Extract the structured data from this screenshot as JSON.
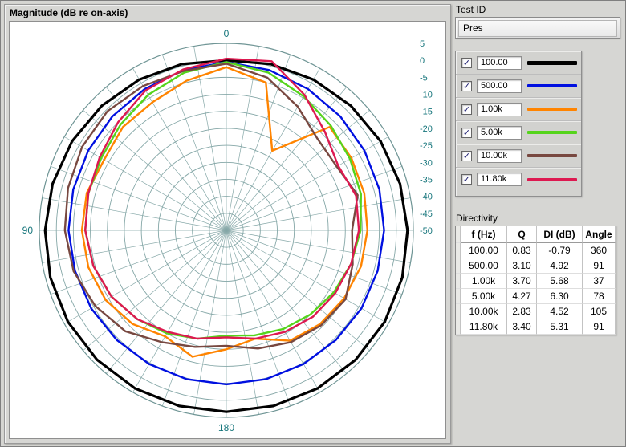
{
  "plot": {
    "title": "Magnitude (dB re on-axis)"
  },
  "test_id": {
    "label": "Test ID",
    "value": "Pres"
  },
  "legend": {
    "items": [
      {
        "label": "100.00",
        "checked": true
      },
      {
        "label": "500.00",
        "checked": true
      },
      {
        "label": "1.00k",
        "checked": true
      },
      {
        "label": "5.00k",
        "checked": true
      },
      {
        "label": "10.00k",
        "checked": true
      },
      {
        "label": "11.80k",
        "checked": true
      }
    ],
    "check_glyph": "✓"
  },
  "directivity": {
    "label": "Directivity",
    "headers": [
      "f (Hz)",
      "Q",
      "DI (dB)",
      "Angle"
    ],
    "rows": [
      [
        "100.00",
        "0.83",
        "-0.79",
        "360"
      ],
      [
        "500.00",
        "3.10",
        "4.92",
        "91"
      ],
      [
        "1.00k",
        "3.70",
        "5.68",
        "37"
      ],
      [
        "5.00k",
        "4.27",
        "6.30",
        "78"
      ],
      [
        "10.00k",
        "2.83",
        "4.52",
        "105"
      ],
      [
        "11.80k",
        "3.40",
        "5.31",
        "91"
      ]
    ]
  },
  "chart_data": {
    "type": "line",
    "subtype": "polar",
    "title": "Magnitude (dB re on-axis)",
    "radial_axis": {
      "min": -50,
      "max": 5,
      "step": 5,
      "labels": [
        "5",
        "0",
        "-5",
        "-10",
        "-15",
        "-20",
        "-25",
        "-30",
        "-35",
        "-40",
        "-45",
        "-50"
      ]
    },
    "angle_labels": [
      {
        "text": "0",
        "deg": 0
      },
      {
        "text": "90",
        "deg": 90
      },
      {
        "text": "180",
        "deg": 180
      }
    ],
    "angle_step_deg": 15,
    "grid_spoke_step_deg": 10,
    "grid_color": "#85a7a7",
    "outer_ring_color": "#6f9595",
    "label_color": "#17767c",
    "series": [
      {
        "name": "100.00",
        "color": "#000000",
        "width": 3.2,
        "values": [
          0,
          0.6,
          1.2,
          1.8,
          2.4,
          2.9,
          3.3,
          3.6,
          3.8,
          3.8,
          3.7,
          3.5,
          3.4,
          3.5,
          3.7,
          3.8,
          3.8,
          3.6,
          3.3,
          2.9,
          2.4,
          1.8,
          1.2,
          0.6,
          0
        ]
      },
      {
        "name": "500.00",
        "color": "#0010e0",
        "width": 2.4,
        "values": [
          -0.5,
          -1.2,
          -2.0,
          -2.6,
          -3.1,
          -3.4,
          -3.6,
          -3.9,
          -4.1,
          -4.4,
          -4.6,
          -4.7,
          -4.7,
          -4.7,
          -4.6,
          -4.4,
          -4.1,
          -3.9,
          -3.6,
          -3.4,
          -3.1,
          -2.6,
          -2.0,
          -1.2,
          -0.5
        ]
      },
      {
        "name": "1.00k",
        "color": "#ff8400",
        "width": 2.4,
        "values": [
          -2,
          -4.5,
          -6.5,
          -7,
          -8.5,
          -7.5,
          -7.5,
          -8,
          -9,
          -11,
          -14,
          -11.5,
          -15,
          -17,
          -12.5,
          -11,
          -10,
          -9,
          -8.5,
          -8,
          -7.5,
          -7,
          -23,
          -5,
          -2
        ]
      },
      {
        "name": "5.00k",
        "color": "#55d41c",
        "width": 2.4,
        "values": [
          -0.5,
          -2,
          -4,
          -6,
          -7.5,
          -8,
          -8.5,
          -9.5,
          -11,
          -13,
          -15,
          -17,
          -19,
          -18,
          -16.5,
          -15,
          -13.5,
          -12,
          -10.5,
          -9,
          -8,
          -6.5,
          -4.5,
          -2,
          -0.5
        ]
      },
      {
        "name": "10.00k",
        "color": "#784840",
        "width": 2.4,
        "values": [
          -1,
          -1.5,
          -1,
          -0.5,
          -1,
          -1.8,
          -2.5,
          -3.5,
          -5.5,
          -8,
          -12,
          -14.5,
          -16,
          -14,
          -12,
          -10.5,
          -9.5,
          -11.5,
          -13,
          -10,
          -12.5,
          -12,
          -8,
          -3.5,
          -1
        ]
      },
      {
        "name": "11.80k",
        "color": "#dd1950",
        "width": 2.4,
        "values": [
          0.5,
          -1,
          -2.5,
          -5,
          -7,
          -8,
          -8.5,
          -9.5,
          -11,
          -13,
          -15.5,
          -17,
          -18.5,
          -17,
          -15.5,
          -14,
          -13,
          -12,
          -11,
          -10.5,
          -12,
          -9,
          -4,
          1.5,
          0.5
        ]
      }
    ]
  }
}
